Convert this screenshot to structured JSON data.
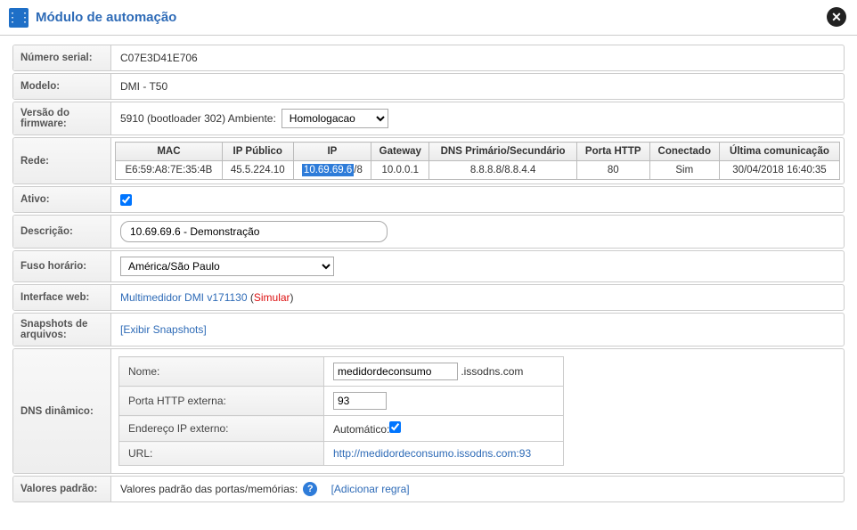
{
  "header": {
    "title": "Módulo de automação"
  },
  "rows": {
    "serial": {
      "label": "Número serial:",
      "value": "C07E3D41E706"
    },
    "modelo": {
      "label": "Modelo:",
      "value": "DMI - T50"
    },
    "firmware": {
      "label": "Versão do firmware:",
      "prefix": "5910 (bootloader 302) Ambiente:",
      "select_value": "Homologacao"
    },
    "rede": {
      "label": "Rede:",
      "headers": {
        "mac": "MAC",
        "ip_publico": "IP Público",
        "ip": "IP",
        "gateway": "Gateway",
        "dns": "DNS Primário/Secundário",
        "porta_http": "Porta HTTP",
        "conectado": "Conectado",
        "ultima": "Última comunicação"
      },
      "row": {
        "mac": "E6:59:A8:7E:35:4B",
        "ip_publico": "45.5.224.10",
        "ip_hl": "10.69.69.6",
        "ip_suffix": "/8",
        "gateway": "10.0.0.1",
        "dns": "8.8.8.8/8.8.4.4",
        "porta_http": "80",
        "conectado": "Sim",
        "ultima": "30/04/2018 16:40:35"
      }
    },
    "ativo": {
      "label": "Ativo:",
      "checked": true
    },
    "descricao": {
      "label": "Descrição:",
      "value": "10.69.69.6 - Demonstração"
    },
    "fuso": {
      "label": "Fuso horário:",
      "value": "América/São Paulo"
    },
    "interface": {
      "label": "Interface web:",
      "link": "Multimedidor DMI v171130",
      "sep_open": " (",
      "simular": "Simular",
      "sep_close": ")"
    },
    "snapshots": {
      "label": "Snapshots de arquivos:",
      "link": "[Exibir Snapshots]"
    },
    "dns_din": {
      "label": "DNS dinâmico:",
      "nome_label": "Nome:",
      "nome_value": "medidordeconsumo",
      "nome_suffix": ".issodns.com",
      "porta_label": "Porta HTTP externa:",
      "porta_value": "93",
      "endereco_label": "Endereço IP externo:",
      "endereco_auto": "Automático:",
      "endereco_checked": true,
      "url_label": "URL:",
      "url_value": "http://medidordeconsumo.issodns.com:93"
    },
    "valores": {
      "label": "Valores padrão:",
      "text": "Valores padrão das portas/memórias:",
      "add_link": "[Adicionar regra]"
    }
  }
}
